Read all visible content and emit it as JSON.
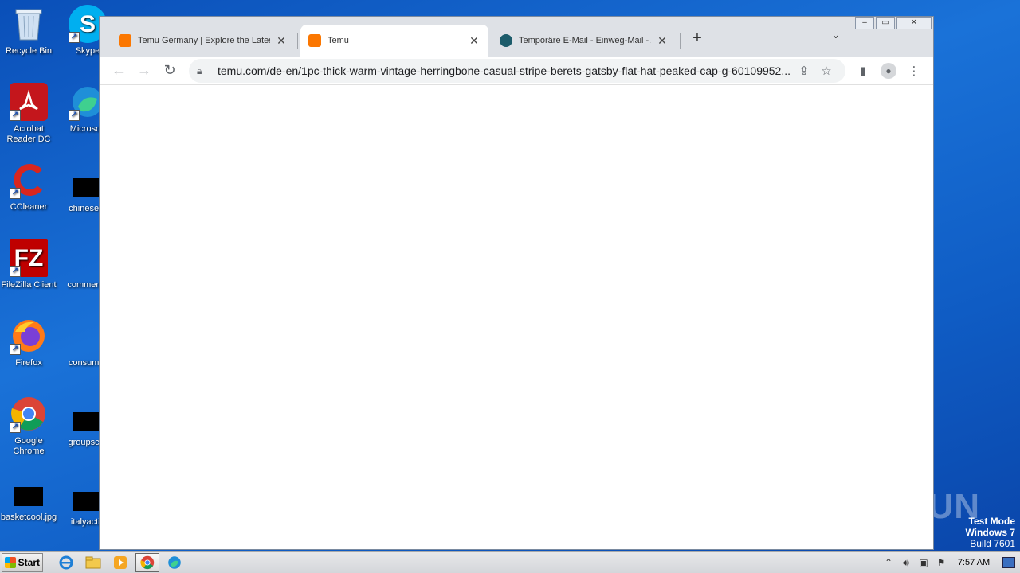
{
  "desktop": {
    "icons": [
      {
        "label": "Recycle Bin"
      },
      {
        "label": "Skype"
      },
      {
        "label": "Acrobat Reader DC"
      },
      {
        "label": "Microsoft"
      },
      {
        "label": "CCleaner"
      },
      {
        "label": "chineseur"
      },
      {
        "label": "FileZilla Client"
      },
      {
        "label": "commerce"
      },
      {
        "label": "Firefox"
      },
      {
        "label": "consumer"
      },
      {
        "label": "Google Chrome"
      },
      {
        "label": "groupscor"
      },
      {
        "label": "basketcool.jpg"
      },
      {
        "label": "italyactiv"
      }
    ],
    "watermark": "ANY RUN",
    "test_mode": {
      "line1": "Test Mode",
      "line2": "Windows 7",
      "line3": "Build 7601"
    }
  },
  "browser": {
    "tabs": [
      {
        "title": "Temu Germany | Explore the Latest C",
        "favicon_color": "#fb7701",
        "active": false
      },
      {
        "title": "Temu",
        "favicon_color": "#fb7701",
        "active": true
      },
      {
        "title": "Temporäre E-Mail - Einweg-Mail - Ano",
        "favicon_color": "#1d5c6b",
        "active": false
      }
    ],
    "new_tab": "+",
    "url": "temu.com/de-en/1pc-thick-warm-vintage-herringbone-casual-stripe-berets-gatsby-flat-hat-peaked-cap-g-60109952..."
  },
  "taskbar": {
    "start_label": "Start",
    "clock": "7:57 AM"
  },
  "colors": {
    "desktop_bg": "#1a66cc",
    "temu_orange": "#fb7701"
  }
}
